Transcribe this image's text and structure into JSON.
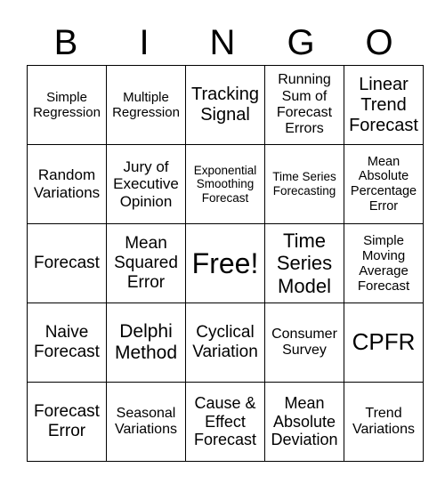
{
  "header": {
    "letters": [
      "B",
      "I",
      "N",
      "G",
      "O"
    ]
  },
  "cells": [
    [
      "Simple Regression",
      "Multiple Regression",
      "Tracking Signal",
      "Running Sum of Forecast Errors",
      "Linear Trend Forecast"
    ],
    [
      "Random Variations",
      "Jury of Executive Opinion",
      "Exponential Smoothing Forecast",
      "Time Series Forecasting",
      "Mean Absolute Percentage Error"
    ],
    [
      "Forecast",
      "Mean Squared Error",
      "Free!",
      "Time Series Model",
      "Simple Moving Average Forecast"
    ],
    [
      "Naive Forecast",
      "Delphi Method",
      "Cyclical Variation",
      "Consumer Survey",
      "CPFR"
    ],
    [
      "Forecast Error",
      "Seasonal Variations",
      "Cause & Effect Forecast",
      "Mean Absolute Deviation",
      "Trend Variations"
    ]
  ]
}
